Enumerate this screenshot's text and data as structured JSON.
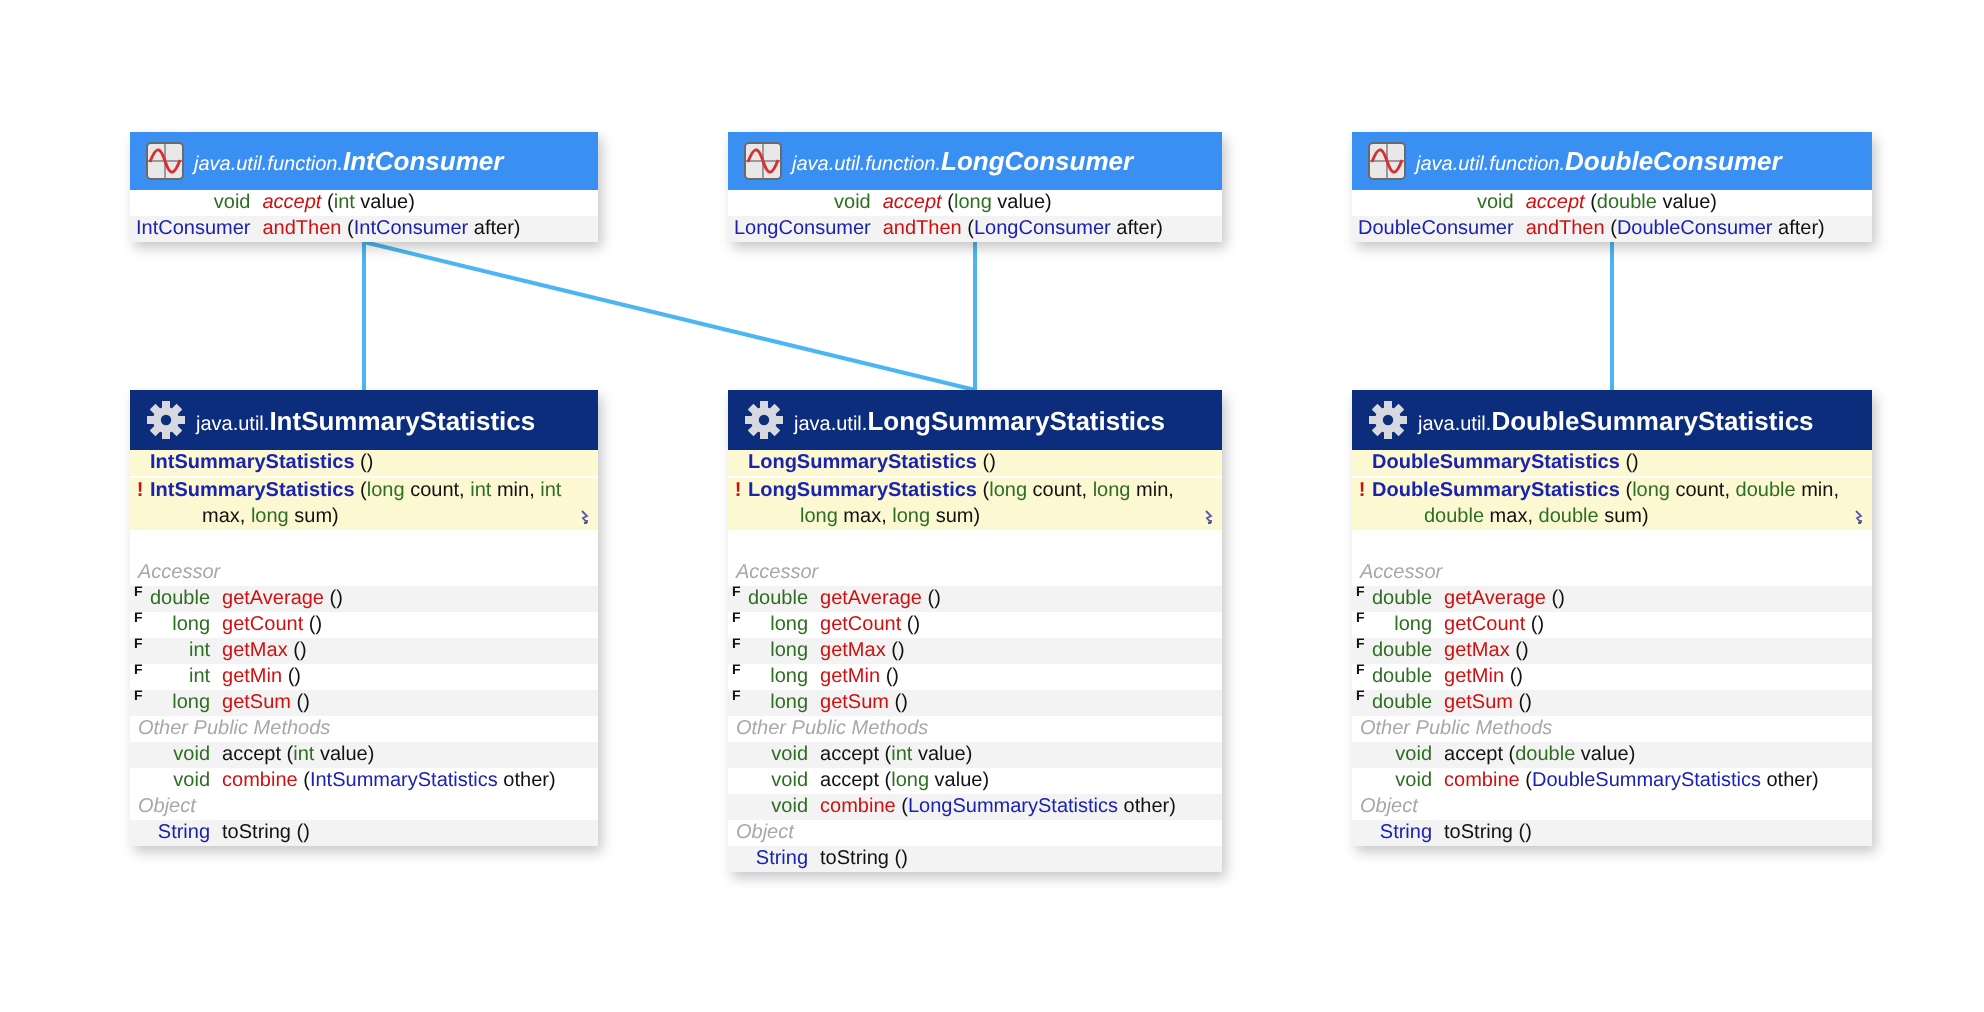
{
  "interfaces": [
    {
      "kind": "interface",
      "package": "java.util.function.",
      "name": "IntConsumer",
      "members": [
        {
          "type": {
            "text": "void",
            "kind": "primitive"
          },
          "name": {
            "text": "accept",
            "kind": "abstract"
          },
          "params": [
            {
              "text": "(",
              "kind": "plain"
            },
            {
              "text": "int",
              "kind": "primitive"
            },
            {
              "text": " value)",
              "kind": "plain"
            }
          ]
        },
        {
          "type": {
            "text": "IntConsumer",
            "kind": "reference"
          },
          "name": {
            "text": "andThen",
            "kind": "method"
          },
          "params": [
            {
              "text": "(",
              "kind": "plain"
            },
            {
              "text": "IntConsumer",
              "kind": "reference"
            },
            {
              "text": " after)",
              "kind": "plain"
            }
          ]
        }
      ]
    },
    {
      "kind": "interface",
      "package": "java.util.function.",
      "name": "LongConsumer",
      "members": [
        {
          "type": {
            "text": "void",
            "kind": "primitive"
          },
          "name": {
            "text": "accept",
            "kind": "abstract"
          },
          "params": [
            {
              "text": "(",
              "kind": "plain"
            },
            {
              "text": "long",
              "kind": "primitive"
            },
            {
              "text": " value)",
              "kind": "plain"
            }
          ]
        },
        {
          "type": {
            "text": "LongConsumer",
            "kind": "reference"
          },
          "name": {
            "text": "andThen",
            "kind": "method"
          },
          "params": [
            {
              "text": "(",
              "kind": "plain"
            },
            {
              "text": "LongConsumer",
              "kind": "reference"
            },
            {
              "text": " after)",
              "kind": "plain"
            }
          ]
        }
      ]
    },
    {
      "kind": "interface",
      "package": "java.util.function.",
      "name": "DoubleConsumer",
      "members": [
        {
          "type": {
            "text": "void",
            "kind": "primitive"
          },
          "name": {
            "text": "accept",
            "kind": "abstract"
          },
          "params": [
            {
              "text": "(",
              "kind": "plain"
            },
            {
              "text": "double",
              "kind": "primitive"
            },
            {
              "text": " value)",
              "kind": "plain"
            }
          ]
        },
        {
          "type": {
            "text": "DoubleConsumer",
            "kind": "reference"
          },
          "name": {
            "text": "andThen",
            "kind": "method"
          },
          "params": [
            {
              "text": "(",
              "kind": "plain"
            },
            {
              "text": "DoubleConsumer",
              "kind": "reference"
            },
            {
              "text": " after)",
              "kind": "plain"
            }
          ]
        }
      ]
    }
  ],
  "classes": [
    {
      "kind": "class",
      "package": "java.util.",
      "name": "IntSummaryStatistics",
      "constructors": [
        {
          "name": "IntSummaryStatistics",
          "params": [
            {
              "text": "()",
              "kind": "plain"
            }
          ],
          "throws_mark": false
        },
        {
          "flag": "!",
          "name": "IntSummaryStatistics",
          "params": [
            {
              "text": "(",
              "kind": "plain"
            },
            {
              "text": "long",
              "kind": "primitive"
            },
            {
              "text": " count, ",
              "kind": "plain"
            },
            {
              "text": "int",
              "kind": "primitive"
            },
            {
              "text": " min, ",
              "kind": "plain"
            },
            {
              "text": "int",
              "kind": "primitive"
            },
            {
              "text": " max, ",
              "kind": "plain"
            },
            {
              "text": "long",
              "kind": "primitive"
            },
            {
              "text": " sum)",
              "kind": "plain"
            }
          ],
          "throws_mark": true
        }
      ],
      "sections": [
        {
          "title": "Accessor",
          "members": [
            {
              "flag": "F",
              "type": {
                "text": "double",
                "kind": "primitive"
              },
              "name": {
                "text": "getAverage",
                "kind": "method"
              },
              "params": [
                {
                  "text": "()",
                  "kind": "plain"
                }
              ]
            },
            {
              "flag": "F",
              "type": {
                "text": "long",
                "kind": "primitive"
              },
              "name": {
                "text": "getCount",
                "kind": "method"
              },
              "params": [
                {
                  "text": "()",
                  "kind": "plain"
                }
              ]
            },
            {
              "flag": "F",
              "type": {
                "text": "int",
                "kind": "primitive"
              },
              "name": {
                "text": "getMax",
                "kind": "method"
              },
              "params": [
                {
                  "text": "()",
                  "kind": "plain"
                }
              ]
            },
            {
              "flag": "F",
              "type": {
                "text": "int",
                "kind": "primitive"
              },
              "name": {
                "text": "getMin",
                "kind": "method"
              },
              "params": [
                {
                  "text": "()",
                  "kind": "plain"
                }
              ]
            },
            {
              "flag": "F",
              "type": {
                "text": "long",
                "kind": "primitive"
              },
              "name": {
                "text": "getSum",
                "kind": "method"
              },
              "params": [
                {
                  "text": "()",
                  "kind": "plain"
                }
              ]
            }
          ]
        },
        {
          "title": "Other Public Methods",
          "members": [
            {
              "type": {
                "text": "void",
                "kind": "primitive"
              },
              "name": {
                "text": "accept",
                "kind": "plain"
              },
              "params": [
                {
                  "text": "(",
                  "kind": "plain"
                },
                {
                  "text": "int",
                  "kind": "primitive"
                },
                {
                  "text": " value)",
                  "kind": "plain"
                }
              ]
            },
            {
              "type": {
                "text": "void",
                "kind": "primitive"
              },
              "name": {
                "text": "combine",
                "kind": "method"
              },
              "params": [
                {
                  "text": "(",
                  "kind": "plain"
                },
                {
                  "text": "IntSummaryStatistics",
                  "kind": "reference"
                },
                {
                  "text": " other)",
                  "kind": "plain"
                }
              ]
            }
          ]
        },
        {
          "title": "Object",
          "members": [
            {
              "type": {
                "text": "String",
                "kind": "reference"
              },
              "name": {
                "text": "toString",
                "kind": "plain"
              },
              "params": [
                {
                  "text": "()",
                  "kind": "plain"
                }
              ]
            }
          ]
        }
      ]
    },
    {
      "kind": "class",
      "package": "java.util.",
      "name": "LongSummaryStatistics",
      "constructors": [
        {
          "name": "LongSummaryStatistics",
          "params": [
            {
              "text": "()",
              "kind": "plain"
            }
          ],
          "throws_mark": false
        },
        {
          "flag": "!",
          "name": "LongSummaryStatistics",
          "params": [
            {
              "text": "(",
              "kind": "plain"
            },
            {
              "text": "long",
              "kind": "primitive"
            },
            {
              "text": " count, ",
              "kind": "plain"
            },
            {
              "text": "long",
              "kind": "primitive"
            },
            {
              "text": " min, ",
              "kind": "plain"
            },
            {
              "text": "long",
              "kind": "primitive"
            },
            {
              "text": " max, ",
              "kind": "plain"
            },
            {
              "text": "long",
              "kind": "primitive"
            },
            {
              "text": " sum)",
              "kind": "plain"
            }
          ],
          "throws_mark": true
        }
      ],
      "sections": [
        {
          "title": "Accessor",
          "members": [
            {
              "flag": "F",
              "type": {
                "text": "double",
                "kind": "primitive"
              },
              "name": {
                "text": "getAverage",
                "kind": "method"
              },
              "params": [
                {
                  "text": "()",
                  "kind": "plain"
                }
              ]
            },
            {
              "flag": "F",
              "type": {
                "text": "long",
                "kind": "primitive"
              },
              "name": {
                "text": "getCount",
                "kind": "method"
              },
              "params": [
                {
                  "text": "()",
                  "kind": "plain"
                }
              ]
            },
            {
              "flag": "F",
              "type": {
                "text": "long",
                "kind": "primitive"
              },
              "name": {
                "text": "getMax",
                "kind": "method"
              },
              "params": [
                {
                  "text": "()",
                  "kind": "plain"
                }
              ]
            },
            {
              "flag": "F",
              "type": {
                "text": "long",
                "kind": "primitive"
              },
              "name": {
                "text": "getMin",
                "kind": "method"
              },
              "params": [
                {
                  "text": "()",
                  "kind": "plain"
                }
              ]
            },
            {
              "flag": "F",
              "type": {
                "text": "long",
                "kind": "primitive"
              },
              "name": {
                "text": "getSum",
                "kind": "method"
              },
              "params": [
                {
                  "text": "()",
                  "kind": "plain"
                }
              ]
            }
          ]
        },
        {
          "title": "Other Public Methods",
          "members": [
            {
              "type": {
                "text": "void",
                "kind": "primitive"
              },
              "name": {
                "text": "accept",
                "kind": "plain"
              },
              "params": [
                {
                  "text": "(",
                  "kind": "plain"
                },
                {
                  "text": "int",
                  "kind": "primitive"
                },
                {
                  "text": " value)",
                  "kind": "plain"
                }
              ]
            },
            {
              "type": {
                "text": "void",
                "kind": "primitive"
              },
              "name": {
                "text": "accept",
                "kind": "plain"
              },
              "params": [
                {
                  "text": "(",
                  "kind": "plain"
                },
                {
                  "text": "long",
                  "kind": "primitive"
                },
                {
                  "text": " value)",
                  "kind": "plain"
                }
              ]
            },
            {
              "type": {
                "text": "void",
                "kind": "primitive"
              },
              "name": {
                "text": "combine",
                "kind": "method"
              },
              "params": [
                {
                  "text": "(",
                  "kind": "plain"
                },
                {
                  "text": "LongSummaryStatistics",
                  "kind": "reference"
                },
                {
                  "text": " other)",
                  "kind": "plain"
                }
              ]
            }
          ]
        },
        {
          "title": "Object",
          "members": [
            {
              "type": {
                "text": "String",
                "kind": "reference"
              },
              "name": {
                "text": "toString",
                "kind": "plain"
              },
              "params": [
                {
                  "text": "()",
                  "kind": "plain"
                }
              ]
            }
          ]
        }
      ]
    },
    {
      "kind": "class",
      "package": "java.util.",
      "name": "DoubleSummaryStatistics",
      "constructors": [
        {
          "name": "DoubleSummaryStatistics",
          "params": [
            {
              "text": "()",
              "kind": "plain"
            }
          ],
          "throws_mark": false
        },
        {
          "flag": "!",
          "name": "DoubleSummaryStatistics",
          "params": [
            {
              "text": "(",
              "kind": "plain"
            },
            {
              "text": "long",
              "kind": "primitive"
            },
            {
              "text": " count, ",
              "kind": "plain"
            },
            {
              "text": "double",
              "kind": "primitive"
            },
            {
              "text": " min, ",
              "kind": "plain"
            },
            {
              "text": "double",
              "kind": "primitive"
            },
            {
              "text": " max, ",
              "kind": "plain"
            },
            {
              "text": "double",
              "kind": "primitive"
            },
            {
              "text": " sum)",
              "kind": "plain"
            }
          ],
          "throws_mark": true
        }
      ],
      "sections": [
        {
          "title": "Accessor",
          "members": [
            {
              "flag": "F",
              "type": {
                "text": "double",
                "kind": "primitive"
              },
              "name": {
                "text": "getAverage",
                "kind": "method"
              },
              "params": [
                {
                  "text": "()",
                  "kind": "plain"
                }
              ]
            },
            {
              "flag": "F",
              "type": {
                "text": "long",
                "kind": "primitive"
              },
              "name": {
                "text": "getCount",
                "kind": "method"
              },
              "params": [
                {
                  "text": "()",
                  "kind": "plain"
                }
              ]
            },
            {
              "flag": "F",
              "type": {
                "text": "double",
                "kind": "primitive"
              },
              "name": {
                "text": "getMax",
                "kind": "method"
              },
              "params": [
                {
                  "text": "()",
                  "kind": "plain"
                }
              ]
            },
            {
              "flag": "F",
              "type": {
                "text": "double",
                "kind": "primitive"
              },
              "name": {
                "text": "getMin",
                "kind": "method"
              },
              "params": [
                {
                  "text": "()",
                  "kind": "plain"
                }
              ]
            },
            {
              "flag": "F",
              "type": {
                "text": "double",
                "kind": "primitive"
              },
              "name": {
                "text": "getSum",
                "kind": "method"
              },
              "params": [
                {
                  "text": "()",
                  "kind": "plain"
                }
              ]
            }
          ]
        },
        {
          "title": "Other Public Methods",
          "members": [
            {
              "type": {
                "text": "void",
                "kind": "primitive"
              },
              "name": {
                "text": "accept",
                "kind": "plain"
              },
              "params": [
                {
                  "text": "(",
                  "kind": "plain"
                },
                {
                  "text": "double",
                  "kind": "primitive"
                },
                {
                  "text": " value)",
                  "kind": "plain"
                }
              ]
            },
            {
              "type": {
                "text": "void",
                "kind": "primitive"
              },
              "name": {
                "text": "combine",
                "kind": "method"
              },
              "params": [
                {
                  "text": "(",
                  "kind": "plain"
                },
                {
                  "text": "DoubleSummaryStatistics",
                  "kind": "reference"
                },
                {
                  "text": " other)",
                  "kind": "plain"
                }
              ]
            }
          ]
        },
        {
          "title": "Object",
          "members": [
            {
              "type": {
                "text": "String",
                "kind": "reference"
              },
              "name": {
                "text": "toString",
                "kind": "plain"
              },
              "params": [
                {
                  "text": "()",
                  "kind": "plain"
                }
              ]
            }
          ]
        }
      ]
    }
  ]
}
